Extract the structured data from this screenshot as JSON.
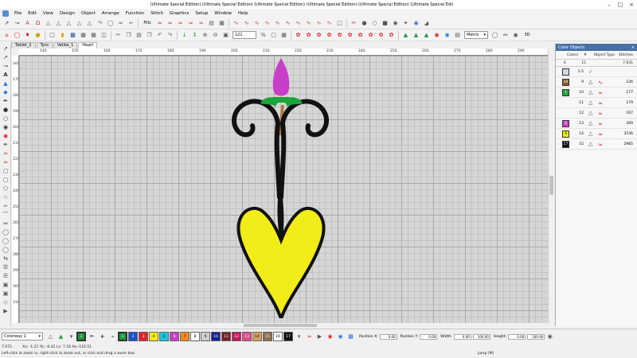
{
  "titlebar": {
    "title": "(Ultimate Special Edition) (Ultimate Special Edition) (Ultimate Special Edition) (Ultimate Special Edition) (Ultimate Special Edition) (Ultimate Special Edi)"
  },
  "menu": [
    "File",
    "Edit",
    "View",
    "Design",
    "Object",
    "Arrange",
    "Function",
    "Stitch",
    "Graphics",
    "Setup",
    "Window",
    "Help"
  ],
  "toolbar1": {
    "fills_label": "Fills"
  },
  "toolbar2": {
    "zoom_value": "121",
    "metric_value": "Metric",
    "threed_label": "3D"
  },
  "tabs": [
    "Tablet_2",
    "Tyro",
    "Velika_1",
    "Heart"
  ],
  "hruler": [
    "140",
    "150",
    "160",
    "170",
    "180",
    "190",
    "200",
    "210",
    "220",
    "230",
    "240",
    "250",
    "260",
    "270",
    "280",
    "290",
    "300"
  ],
  "vruler": [
    "160",
    "170",
    "180",
    "190",
    "200",
    "210",
    "220",
    "230",
    "240",
    "250",
    "260",
    "270",
    "280",
    "290",
    "300",
    "310",
    "320",
    "330"
  ],
  "objects_panel": {
    "title": "Color Objects",
    "header": {
      "col1": "Colors",
      "col2": "#",
      "col3": "Object Type",
      "col4": "Stitches"
    },
    "summary": {
      "colors": "6",
      "count": "15",
      "stitches": "7,931"
    },
    "rows": [
      {
        "color": "#cfd8e6",
        "code": "",
        "num": "1-5",
        "type": "lettering",
        "stitches": ""
      },
      {
        "color": "#8a5a2b",
        "code": "34",
        "num": "9",
        "type": "run",
        "stitches": "126"
      },
      {
        "color": "#1aa43a",
        "code": "1",
        "num": "10",
        "type": "fill",
        "stitches": "177"
      },
      {
        "color": "#1aa43a",
        "code": "",
        "num": "11",
        "type": "fill",
        "stitches": "179"
      },
      {
        "color": "#1aa43a",
        "code": "",
        "num": "12",
        "type": "fill",
        "stitches": "167"
      },
      {
        "color": "#c93ec9",
        "code": "6",
        "num": "13",
        "type": "fill",
        "stitches": "369"
      },
      {
        "color": "#f2ec18",
        "code": "4",
        "num": "14",
        "type": "fill",
        "stitches": "3536"
      },
      {
        "color": "#111111",
        "code": "17",
        "num": "15",
        "type": "satin",
        "stitches": "2985"
      }
    ]
  },
  "bottombar": {
    "colorway": "Colorway 1",
    "swatches": [
      {
        "code": "1",
        "color": "#1a9b3a"
      },
      {
        "code": "2",
        "color": "#1f4fd1"
      },
      {
        "code": "3",
        "color": "#e0232a"
      },
      {
        "code": "4",
        "color": "#f5ea14"
      },
      {
        "code": "5",
        "color": "#1fc4d9"
      },
      {
        "code": "6",
        "color": "#c93ec9"
      },
      {
        "code": "7",
        "color": "#f08c1e"
      },
      {
        "code": "8",
        "color": "#ffffff"
      },
      {
        "code": "9",
        "color": "#cfcfcf"
      },
      {
        "code": "10",
        "color": "#15208f"
      },
      {
        "code": "11",
        "color": "#7a1f1f"
      },
      {
        "code": "12",
        "color": "#c2185b"
      },
      {
        "code": "13",
        "color": "#e44a8a"
      },
      {
        "code": "14",
        "color": "#d9a15c"
      },
      {
        "code": "15",
        "color": "#8b6e4e"
      },
      {
        "code": "16",
        "color": "#ffffff"
      },
      {
        "code": "17",
        "color": "#111111"
      }
    ],
    "position_x_label": "Position X:",
    "position_x": "0.00",
    "position_y_label": "Position Y:",
    "position_y": "0.00",
    "width_label": "Width:",
    "width": "0.00",
    "width_pct": "100.00",
    "height_label": "Height:",
    "height": "0.00",
    "height_pct": "100.00"
  },
  "status": {
    "coords1": "7.072",
    "coords2": "Xo: -1.21 Yo: -6.42 Lx: 7.18 Ao:-116.51",
    "hint": "Left-click to zoom in, right-click to zoom out, or click and drag a zoom box.",
    "jump": "Jump (M)"
  },
  "colors": {
    "accent": "#4a6fa5",
    "canvas": "#d6d6d6",
    "fill_yellow": "#f2ec18",
    "fill_magenta": "#c93ec9",
    "fill_green": "#1aa43a",
    "outline": "#111111"
  }
}
